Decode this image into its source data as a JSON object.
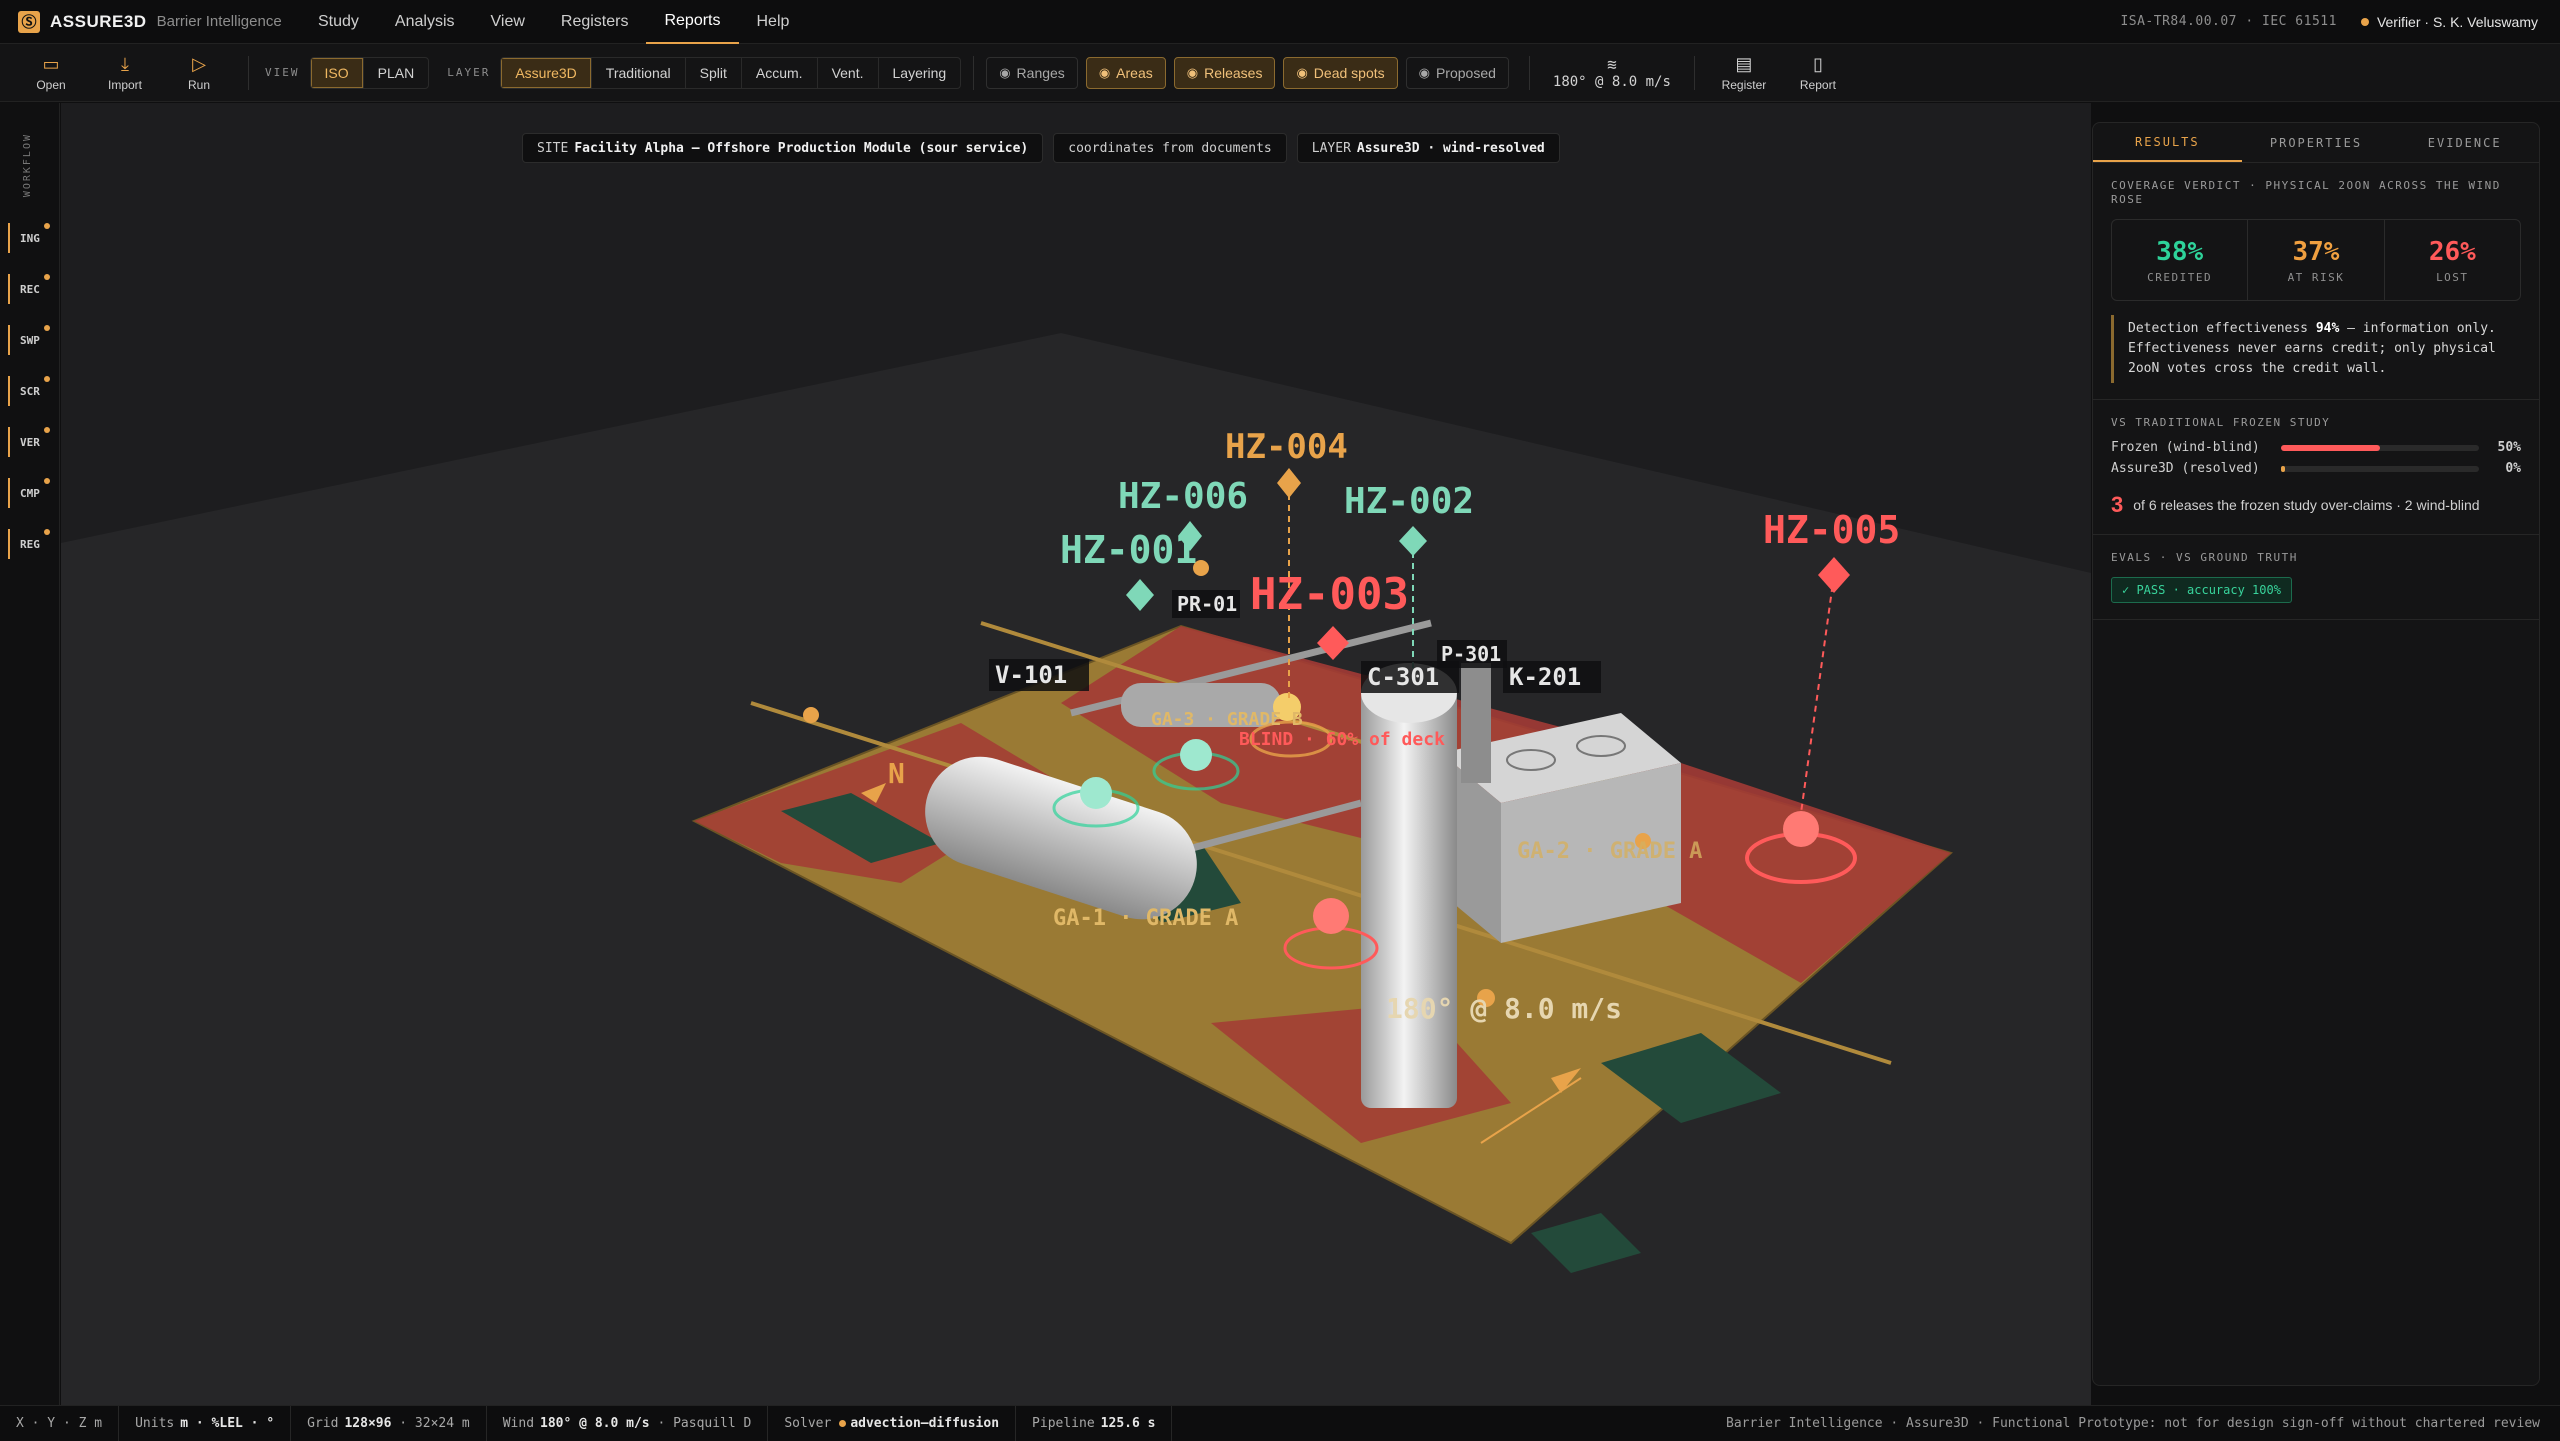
{
  "brand": {
    "name": "ASSURE3D",
    "sub": "Barrier Intelligence"
  },
  "menu": [
    "Study",
    "Analysis",
    "View",
    "Registers",
    "Reports",
    "Help"
  ],
  "header": {
    "standards": "ISA-TR84.00.07 · IEC 61511",
    "verifier": "Verifier · S. K. Veluswamy"
  },
  "toolbar": {
    "open": "Open",
    "import": "Import",
    "run": "Run",
    "view_label": "VIEW",
    "views": [
      "ISO",
      "PLAN"
    ],
    "layer_label": "LAYER",
    "layers": [
      "Assure3D",
      "Traditional",
      "Split",
      "Accum.",
      "Vent.",
      "Layering"
    ],
    "toggles": [
      "Ranges",
      "Areas",
      "Releases",
      "Dead spots",
      "Proposed"
    ],
    "wind": "180° @ 8.0 m/s",
    "register": "Register",
    "report": "Report"
  },
  "rail": {
    "title": "WORKFLOW",
    "items": [
      "ING",
      "REC",
      "SWP",
      "SCR",
      "VER",
      "CMP",
      "REG"
    ]
  },
  "chips": {
    "site_key": "SITE",
    "site": "Facility Alpha — Offshore Production Module (sour service)",
    "coords": "coordinates from documents",
    "layer_key": "LAYER",
    "layer": "Assure3D · wind-resolved"
  },
  "scene": {
    "hazards": [
      "HZ-004",
      "HZ-006",
      "HZ-002",
      "HZ-001",
      "HZ-003",
      "HZ-005"
    ],
    "equipment": [
      "PR-01",
      "V-101",
      "P-301",
      "C-301",
      "K-201"
    ],
    "areas": [
      "GA-3 · GRADE B",
      "GA-1 · GRADE A",
      "GA-2 · GRADE A"
    ],
    "blind": "BLIND · 60% of deck",
    "north": "N",
    "wind": "180° @ 8.0 m/s"
  },
  "panel": {
    "tabs": [
      "RESULTS",
      "PROPERTIES",
      "EVIDENCE"
    ],
    "verdict_head": "COVERAGE VERDICT · PHYSICAL 2OON ACROSS THE WIND ROSE",
    "stats": [
      {
        "v": "38%",
        "l": "CREDITED",
        "c": "#2ed39a"
      },
      {
        "v": "37%",
        "l": "AT RISK",
        "c": "#f0a040"
      },
      {
        "v": "26%",
        "l": "LOST",
        "c": "#ff5a5a"
      }
    ],
    "note_a": "Detection effectiveness",
    "note_b": "94%",
    "note_c": "— information only. Effectiveness never earns credit; only physical 2ooN votes cross the credit wall.",
    "cmp_head": "VS TRADITIONAL FROZEN STUDY",
    "bars": [
      {
        "label": "Frozen (wind-blind)",
        "value": "50%",
        "frac": 0.5,
        "color": "#ff5a5a"
      },
      {
        "label": "Assure3D (resolved)",
        "value": "0%",
        "frac": 0.02,
        "color": "#e8a34a"
      }
    ],
    "claim_n": "3",
    "claim": "of 6 releases the frozen study over-claims · 2 wind-blind",
    "eval_head": "EVALS · VS GROUND TRUTH",
    "pass": "✓ PASS · accuracy 100%"
  },
  "status": {
    "coords": "X · Y · Z m",
    "units_k": "Units",
    "units": "m · %LEL · °",
    "grid_k": "Grid",
    "grid": "128×96",
    "grid_sz": "· 32×24 m",
    "wind_k": "Wind",
    "wind": "180° @ 8.0 m/s",
    "pasq": "· Pasquill D",
    "solver_k": "Solver",
    "solver": "advection–diffusion",
    "pipe_k": "Pipeline",
    "pipe": "125.6 s",
    "footer": "Barrier Intelligence · Assure3D · Functional Prototype: not for design sign-off without chartered review"
  }
}
